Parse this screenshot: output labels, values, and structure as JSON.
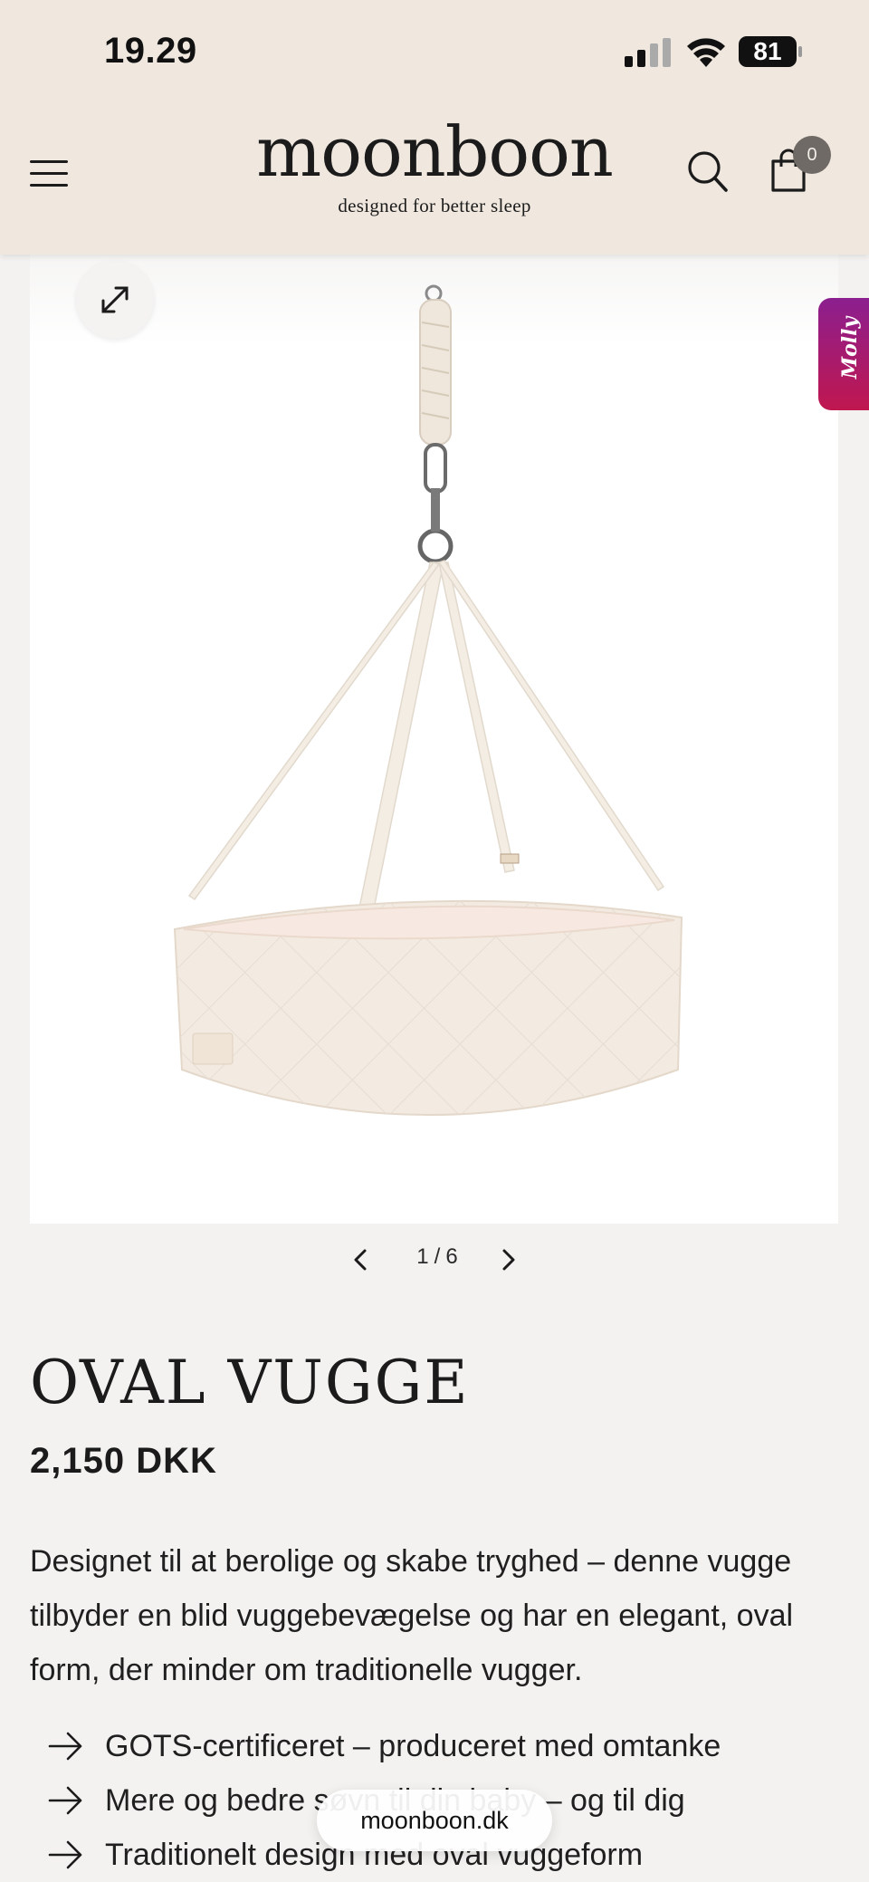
{
  "status_bar": {
    "time": "19.29",
    "battery": "81"
  },
  "header": {
    "logo": "moonboon",
    "tagline": "designed for better sleep",
    "cart_count": "0",
    "bg_color": "#f0e8df"
  },
  "gallery": {
    "current": "1",
    "separator": "/",
    "total": "6"
  },
  "chat_widget": {
    "label": "Molly",
    "colors": [
      "#8b1f8f",
      "#c0174f"
    ]
  },
  "product": {
    "title": "OVAL VUGGE",
    "price": "2,150 DKK",
    "description": "Designet til at berolige og skabe tryghed – denne vugge tilbyder en blid vuggebevægelse og har en elegant, oval form, der minder om traditionelle vugger.",
    "features": [
      "GOTS-certificeret – produceret med omtanke",
      "Mere og bedre søvn til din baby – og til dig",
      "Traditionelt design med oval vuggeform"
    ]
  },
  "browser": {
    "url": "moonboon.dk"
  }
}
